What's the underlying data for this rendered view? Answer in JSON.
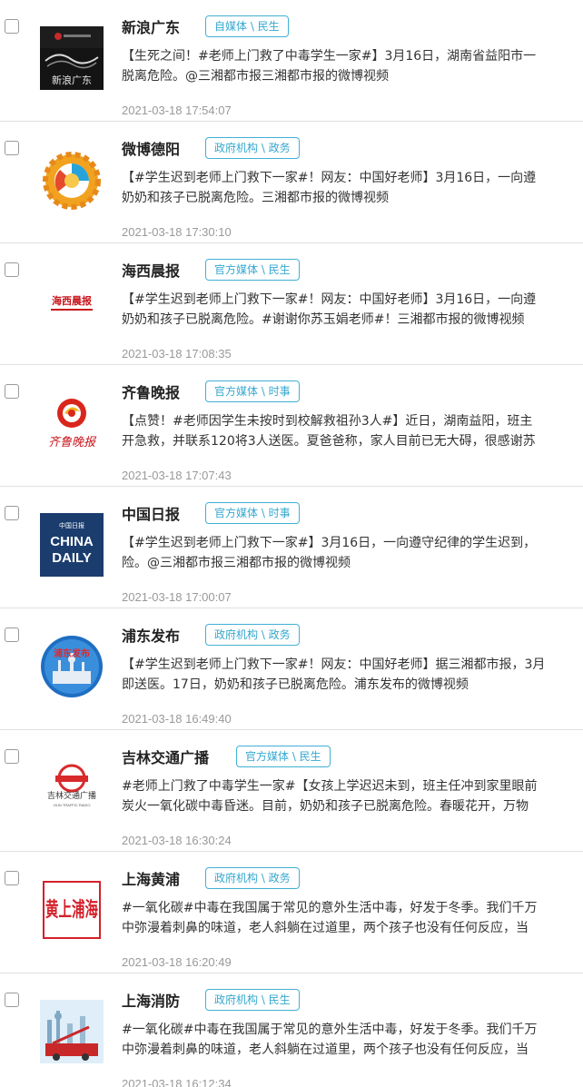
{
  "items": [
    {
      "name": "新浪广东",
      "tag": "自媒体 \\ 民生",
      "line1": "【生死之间！#老师上门救了中毒学生一家#】3月16日，湖南省益阳市一",
      "line2": "脱离危险。@三湘都市报三湘都市报的微博视频",
      "time": "2021-03-18 17:54:07",
      "avatar_text": "新浪广东"
    },
    {
      "name": "微博德阳",
      "tag": "政府机构 \\ 政务",
      "line1": "【#学生迟到老师上门救下一家#！网友：中国好老师】3月16日，一向遵",
      "line2": "奶奶和孩子已脱离危险。三湘都市报的微博视频",
      "time": "2021-03-18 17:30:10",
      "avatar_text": ""
    },
    {
      "name": "海西晨报",
      "tag": "官方媒体 \\ 民生",
      "line1": "【#学生迟到老师上门救下一家#！网友：中国好老师】3月16日，一向遵",
      "line2": "奶奶和孩子已脱离危险。#谢谢你苏玉娟老师#！三湘都市报的微博视频",
      "time": "2021-03-18 17:08:35",
      "avatar_text": "海西晨报"
    },
    {
      "name": "齐鲁晚报",
      "tag": "官方媒体 \\ 时事",
      "line1": "【点赞！#老师因学生未按时到校解救祖孙3人#】近日，湖南益阳，班主",
      "line2": "开急救，并联系120将3人送医。夏爸爸称，家人目前已无大碍，很感谢苏",
      "time": "2021-03-18 17:07:43",
      "avatar_text": "齐鲁晚报"
    },
    {
      "name": "中国日报",
      "tag": "官方媒体 \\ 时事",
      "line1": "【#学生迟到老师上门救下一家#】3月16日，一向遵守纪律的学生迟到，",
      "line2": "险。@三湘都市报三湘都市报的微博视频",
      "time": "2021-03-18 17:00:07",
      "avatar_text_top": "中国日报",
      "avatar_text_mid": "CHINA",
      "avatar_text_bot": "DAILY"
    },
    {
      "name": "浦东发布",
      "tag": "政府机构 \\ 政务",
      "line1": "【#学生迟到老师上门救下一家#！网友：中国好老师】据三湘都市报，3月",
      "line2": "即送医。17日，奶奶和孩子已脱离危险。浦东发布的微博视频",
      "time": "2021-03-18 16:49:40",
      "avatar_text": "浦东发布"
    },
    {
      "name": "吉林交通广播",
      "tag": "官方媒体 \\ 民生",
      "line1": "#老师上门救了中毒学生一家#【女孩上学迟迟未到，班主任冲到家里眼前",
      "line2": "炭火一氧化碳中毒昏迷。目前，奶奶和孩子已脱离危险。春暖花开，万物",
      "time": "2021-03-18 16:30:24",
      "avatar_text": "吉林交通广播",
      "avatar_text_small": "JILIN TRAFFIC RADIO"
    },
    {
      "name": "上海黄浦",
      "tag": "政府机构 \\ 政务",
      "line1": "#一氧化碳#中毒在我国属于常见的意外生活中毒，好发于冬季。我们千万",
      "line2": "中弥漫着刺鼻的味道，老人斜躺在过道里，两个孩子也没有任何反应，当",
      "time": "2021-03-18 16:20:49",
      "avatar_text": "黄上浦海"
    },
    {
      "name": "上海消防",
      "tag": "政府机构 \\ 民生",
      "line1": "#一氧化碳#中毒在我国属于常见的意外生活中毒，好发于冬季。我们千万",
      "line2": "中弥漫着刺鼻的味道，老人斜躺在过道里，两个孩子也没有任何反应，当",
      "time": "2021-03-18 16:12:34",
      "avatar_text": ""
    }
  ]
}
